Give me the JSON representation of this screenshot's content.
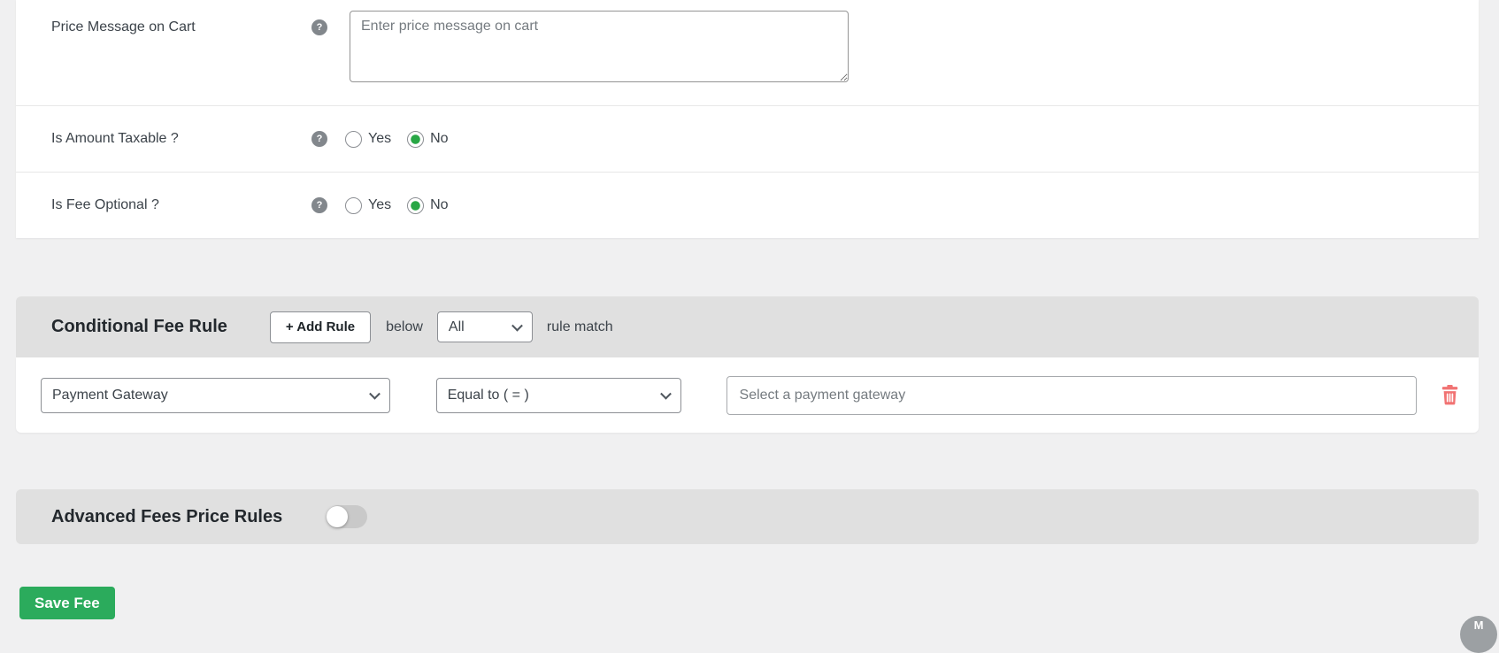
{
  "icons": {
    "help": "?"
  },
  "card": {
    "price_message": {
      "label": "Price Message on Cart",
      "placeholder": "Enter price message on cart"
    },
    "taxable": {
      "label": "Is Amount Taxable ?",
      "yes_label": "Yes",
      "no_label": "No",
      "selected": "No"
    },
    "fee_optional": {
      "label": "Is Fee Optional ?",
      "yes_label": "Yes",
      "no_label": "No",
      "selected": "No"
    }
  },
  "conditional_rule": {
    "title": "Conditional Fee Rule",
    "add_rule_button": "+ Add Rule",
    "below_text": "below",
    "match_select_value": "All",
    "match_suffix": "rule match",
    "rule": {
      "field_value": "Payment Gateway",
      "operator_value": "Equal to ( = )",
      "value_placeholder": "Select a payment gateway",
      "delete_icon": "trash"
    }
  },
  "advanced_rules": {
    "title": "Advanced Fees Price Rules",
    "toggle_state": "off"
  },
  "save_button_label": "Save Fee",
  "floating_badge_glyph": "M",
  "colors": {
    "page_bg": "#f0f0f1",
    "section_header_bg": "#e0e0e0",
    "radio_selected_green": "#28a745",
    "save_button_green": "#2bab5c",
    "trash_red": "#f17373",
    "help_icon_gray": "#82878c"
  }
}
